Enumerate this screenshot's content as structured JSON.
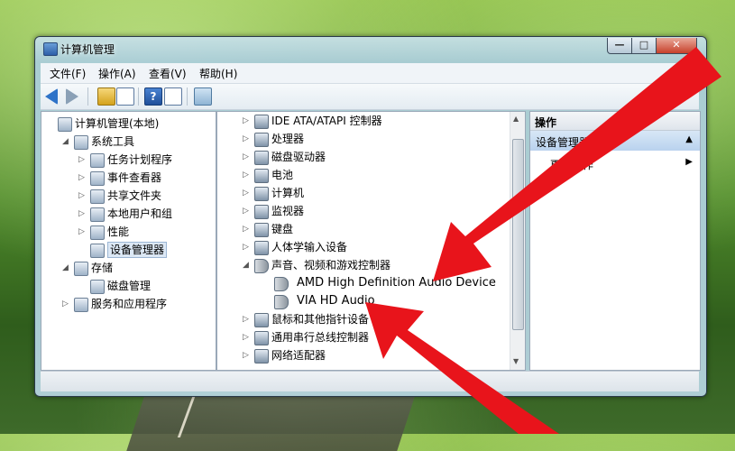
{
  "window": {
    "title": "计算机管理",
    "buttons": {
      "minimize": "—",
      "maximize": "□",
      "close": "✕"
    }
  },
  "menu": [
    "文件(F)",
    "操作(A)",
    "查看(V)",
    "帮助(H)"
  ],
  "toolbar": {
    "help": "?"
  },
  "left_tree": [
    {
      "label": "计算机管理(本地)",
      "indent": 0,
      "expander": "",
      "icon": "computer-management-icon"
    },
    {
      "label": "系统工具",
      "indent": 1,
      "expander": "◢",
      "icon": "tools-icon"
    },
    {
      "label": "任务计划程序",
      "indent": 2,
      "expander": "▷",
      "icon": "clock-icon"
    },
    {
      "label": "事件查看器",
      "indent": 2,
      "expander": "▷",
      "icon": "event-viewer-icon"
    },
    {
      "label": "共享文件夹",
      "indent": 2,
      "expander": "▷",
      "icon": "shared-folder-icon"
    },
    {
      "label": "本地用户和组",
      "indent": 2,
      "expander": "▷",
      "icon": "users-icon"
    },
    {
      "label": "性能",
      "indent": 2,
      "expander": "▷",
      "icon": "performance-icon"
    },
    {
      "label": "设备管理器",
      "indent": 2,
      "expander": "",
      "icon": "device-manager-icon",
      "selected": true
    },
    {
      "label": "存储",
      "indent": 1,
      "expander": "◢",
      "icon": "storage-icon"
    },
    {
      "label": "磁盘管理",
      "indent": 2,
      "expander": "",
      "icon": "disk-management-icon"
    },
    {
      "label": "服务和应用程序",
      "indent": 1,
      "expander": "▷",
      "icon": "services-icon"
    }
  ],
  "device_tree": [
    {
      "label": "IDE ATA/ATAPI 控制器",
      "expander": "▷",
      "indent": 0,
      "icon": "ide-controller-icon"
    },
    {
      "label": "处理器",
      "expander": "▷",
      "indent": 0,
      "icon": "processor-icon"
    },
    {
      "label": "磁盘驱动器",
      "expander": "▷",
      "indent": 0,
      "icon": "disk-drive-icon"
    },
    {
      "label": "电池",
      "expander": "▷",
      "indent": 0,
      "icon": "battery-icon"
    },
    {
      "label": "计算机",
      "expander": "▷",
      "indent": 0,
      "icon": "computer-icon"
    },
    {
      "label": "监视器",
      "expander": "▷",
      "indent": 0,
      "icon": "monitor-icon"
    },
    {
      "label": "键盘",
      "expander": "▷",
      "indent": 0,
      "icon": "keyboard-icon"
    },
    {
      "label": "人体学输入设备",
      "expander": "▷",
      "indent": 0,
      "icon": "hid-icon"
    },
    {
      "label": "声音、视频和游戏控制器",
      "expander": "◢",
      "indent": 0,
      "icon": "speaker-icon"
    },
    {
      "label": "AMD High Definition Audio Device",
      "expander": "",
      "indent": 1,
      "icon": "speaker-icon",
      "large": true
    },
    {
      "label": "VIA HD Audio",
      "expander": "",
      "indent": 1,
      "icon": "speaker-icon",
      "large": true
    },
    {
      "label": "鼠标和其他指针设备",
      "expander": "▷",
      "indent": 0,
      "icon": "mouse-icon"
    },
    {
      "label": "通用串行总线控制器",
      "expander": "▷",
      "indent": 0,
      "icon": "usb-icon"
    },
    {
      "label": "网络适配器",
      "expander": "▷",
      "indent": 0,
      "icon": "network-adapter-icon"
    }
  ],
  "actions": {
    "header": "操作",
    "section": "设备管理器",
    "more": "更多操作"
  },
  "colors": {
    "arrow": "#e8141b",
    "selection": "#dce8f5"
  }
}
